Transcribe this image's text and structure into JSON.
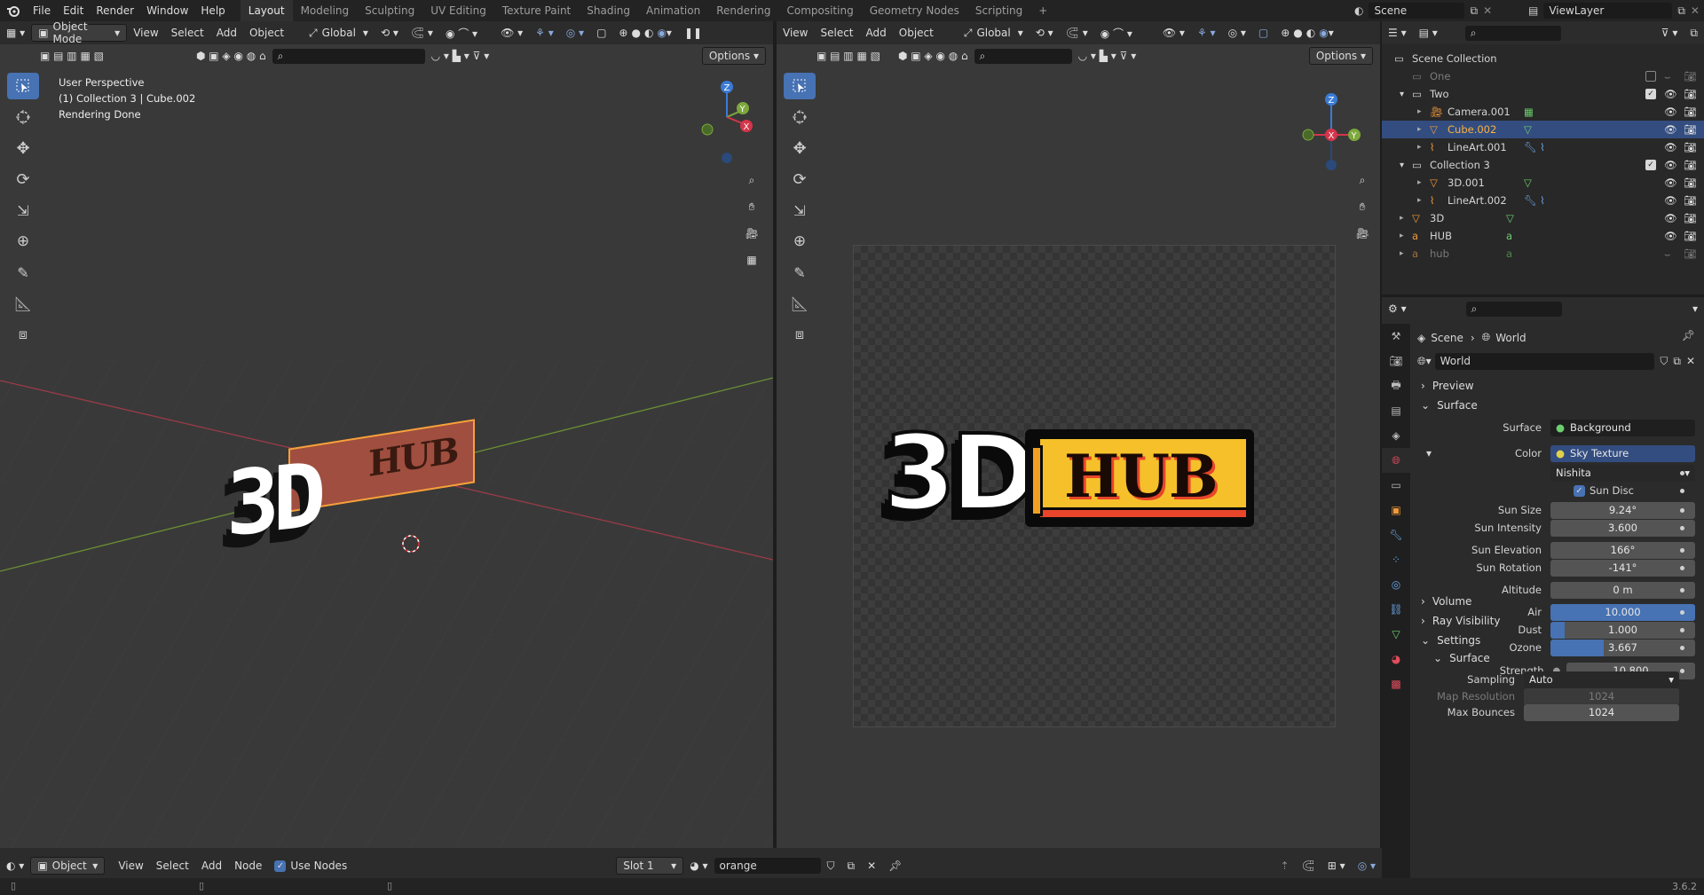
{
  "topbar": {
    "menus": [
      "File",
      "Edit",
      "Render",
      "Window",
      "Help"
    ],
    "workspaces": [
      "Layout",
      "Modeling",
      "Sculpting",
      "UV Editing",
      "Texture Paint",
      "Shading",
      "Animation",
      "Rendering",
      "Compositing",
      "Geometry Nodes",
      "Scripting"
    ],
    "active_workspace": "Layout",
    "scene": "Scene",
    "view_layer": "ViewLayer"
  },
  "viewport_left": {
    "mode": "Object Mode",
    "menus": [
      "View",
      "Select",
      "Add",
      "Object"
    ],
    "orientation": "Global",
    "options_label": "Options",
    "overlay_lines": [
      "User Perspective",
      "(1) Collection 3 | Cube.002",
      "Rendering Done"
    ],
    "logo_left": "3D",
    "logo_right": "HUB"
  },
  "viewport_right": {
    "menus": [
      "View",
      "Select",
      "Add",
      "Object"
    ],
    "orientation": "Global",
    "options_label": "Options",
    "logo_left": "3D",
    "logo_right": "HUB"
  },
  "outliner": {
    "search_placeholder": "",
    "rows": [
      {
        "name": "Scene Collection",
        "indent": 0
      },
      {
        "name": "One",
        "indent": 1
      },
      {
        "name": "Two",
        "indent": 1
      },
      {
        "name": "Camera.001",
        "indent": 2
      },
      {
        "name": "Cube.002",
        "indent": 2
      },
      {
        "name": "LineArt.001",
        "indent": 2
      },
      {
        "name": "Collection 3",
        "indent": 1
      },
      {
        "name": "3D.001",
        "indent": 2
      },
      {
        "name": "LineArt.002",
        "indent": 2
      },
      {
        "name": "3D",
        "indent": 1
      },
      {
        "name": "HUB",
        "indent": 1
      },
      {
        "name": "hub",
        "indent": 1
      }
    ]
  },
  "properties": {
    "breadcrumb": [
      "Scene",
      "World"
    ],
    "world_name": "World",
    "panels": {
      "preview": "Preview",
      "surface": "Surface",
      "volume": "Volume",
      "ray_visibility": "Ray Visibility",
      "settings": "Settings",
      "settings_surface": "Surface"
    },
    "surface_label": "Surface",
    "surface_value": "Background",
    "color_label": "Color",
    "color_value": "Sky Texture",
    "sky_type": "Nishita",
    "sun_disc_label": "Sun Disc",
    "fields": [
      {
        "label": "Sun Size",
        "value": "9.24°",
        "fill": 0
      },
      {
        "label": "Sun Intensity",
        "value": "3.600",
        "fill": 0
      },
      {
        "label": "Sun Elevation",
        "value": "166°",
        "fill": 0
      },
      {
        "label": "Sun Rotation",
        "value": "-141°",
        "fill": 0
      },
      {
        "label": "Altitude",
        "value": "0 m",
        "fill": 0
      },
      {
        "label": "Air",
        "value": "10.000",
        "fill": 1.0
      },
      {
        "label": "Dust",
        "value": "1.000",
        "fill": 0.1
      },
      {
        "label": "Ozone",
        "value": "3.667",
        "fill": 0.37
      },
      {
        "label": "Strength",
        "value": "10.800",
        "fill": 0
      }
    ],
    "sampling_label": "Sampling",
    "sampling_value": "Auto",
    "map_resolution_label": "Map Resolution",
    "map_resolution_value": "1024",
    "max_bounces_label": "Max Bounces",
    "max_bounces_value": "1024"
  },
  "nodebar": {
    "type": "Object",
    "menus": [
      "View",
      "Select",
      "Add",
      "Node"
    ],
    "use_nodes_label": "Use Nodes",
    "slot": "Slot 1",
    "material": "orange"
  },
  "status": {
    "version": "3.6.2"
  },
  "colors": {
    "accent": "#4772b3",
    "selected_text": "#f9b13d",
    "logo_yellow": "#f5c02a",
    "logo_red": "#e8452a"
  }
}
